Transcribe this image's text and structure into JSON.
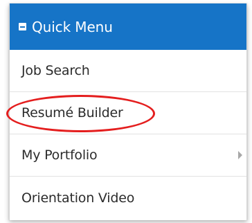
{
  "menu": {
    "title": "Quick Menu",
    "header_icon": "collapse-minus-icon",
    "accent_color": "#1674c7",
    "items": [
      {
        "label": "Job Search",
        "has_submenu": false
      },
      {
        "label": "Resumé Builder",
        "has_submenu": false,
        "highlighted": true
      },
      {
        "label": "My Portfolio",
        "has_submenu": true,
        "submenu_icon": "chevron-right-icon"
      },
      {
        "label": "Orientation Video",
        "has_submenu": false
      }
    ]
  },
  "annotation": {
    "type": "ellipse",
    "color": "#e41e1e"
  }
}
